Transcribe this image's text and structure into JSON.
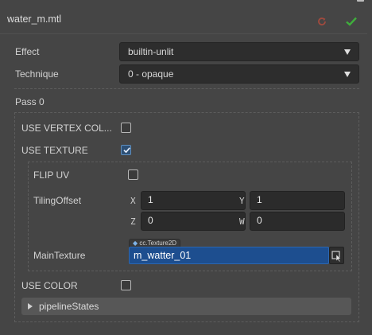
{
  "header": {
    "title": "water_m.mtl",
    "revert_icon": "revert-icon",
    "apply_icon": "apply-check-icon"
  },
  "colors": {
    "accent_blue": "#1d4e8f",
    "revert_red": "#a04a3e",
    "apply_green": "#3fae3c"
  },
  "effect": {
    "label": "Effect",
    "value": "builtin-unlit"
  },
  "technique": {
    "label": "Technique",
    "value": "0 - opaque"
  },
  "pass": {
    "title": "Pass 0",
    "use_vertex_color": {
      "label": "USE VERTEX COL...",
      "checked": false
    },
    "use_texture": {
      "label": "USE TEXTURE",
      "checked": true,
      "flip_uv": {
        "label": "FLIP UV",
        "checked": false
      },
      "tiling_offset": {
        "label": "TilingOffset",
        "x_label": "X",
        "x": "1",
        "y_label": "Y",
        "y": "1",
        "z_label": "Z",
        "z": "0",
        "w_label": "W",
        "w": "0"
      },
      "main_texture": {
        "label": "MainTexture",
        "type": "cc.Texture2D",
        "value": "m_watter_01"
      }
    },
    "use_color": {
      "label": "USE COLOR",
      "checked": false
    },
    "pipeline_states": {
      "label": "pipelineStates",
      "expanded": false
    }
  }
}
